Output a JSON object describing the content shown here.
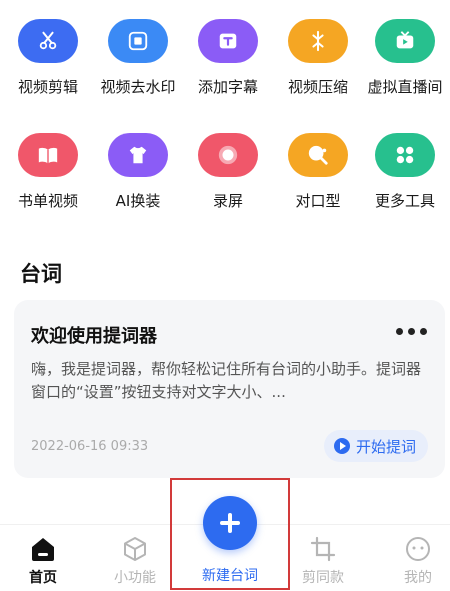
{
  "tools": [
    {
      "label": "视频剪辑",
      "icon": "scissors-icon",
      "color": "#3d6cf2"
    },
    {
      "label": "视频去水印",
      "icon": "watermark-icon",
      "color": "#3b8af5"
    },
    {
      "label": "添加字幕",
      "icon": "subtitle-icon",
      "color": "#8b5cf6"
    },
    {
      "label": "视频压缩",
      "icon": "compress-icon",
      "color": "#f5a623"
    },
    {
      "label": "虚拟直播间",
      "icon": "live-tv-icon",
      "color": "#27c08e"
    },
    {
      "label": "书单视频",
      "icon": "book-icon",
      "color": "#f0576a"
    },
    {
      "label": "AI换装",
      "icon": "shirt-icon",
      "color": "#8b5cf6"
    },
    {
      "label": "录屏",
      "icon": "record-icon",
      "color": "#f0576a"
    },
    {
      "label": "对口型",
      "icon": "lipsync-icon",
      "color": "#f5a623"
    },
    {
      "label": "更多工具",
      "icon": "more-tools-icon",
      "color": "#27c08e"
    }
  ],
  "section": {
    "title": "台词"
  },
  "card": {
    "title": "欢迎使用提词器",
    "body": "嗨，我是提词器，帮你轻松记住所有台词的小助手。提词器窗口的“设置”按钮支持对文字大小、...",
    "date": "2022-06-16 09:33",
    "start_label": "开始提词"
  },
  "tabbar": {
    "items": [
      {
        "label": "首页",
        "icon": "home-icon",
        "active": true
      },
      {
        "label": "小功能",
        "icon": "cube-icon",
        "active": false
      },
      {
        "label": "剪同款",
        "icon": "crop-icon",
        "active": false
      },
      {
        "label": "我的",
        "icon": "profile-icon",
        "active": false
      }
    ],
    "new_label": "新建台词"
  }
}
